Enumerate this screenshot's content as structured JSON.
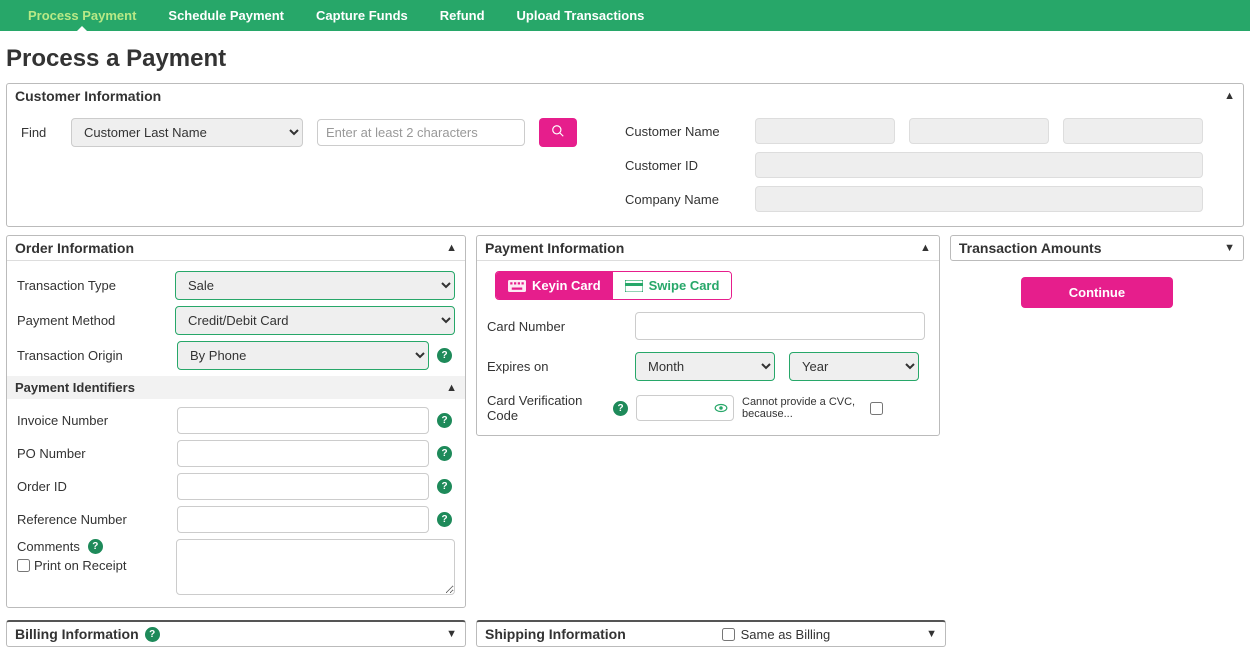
{
  "nav": {
    "items": [
      "Process Payment",
      "Schedule Payment",
      "Capture Funds",
      "Refund",
      "Upload Transactions"
    ]
  },
  "page_title": "Process a Payment",
  "customer_info": {
    "title": "Customer Information",
    "find_label": "Find",
    "find_select": "Customer Last Name",
    "search_placeholder": "Enter at least 2 characters",
    "labels": {
      "name": "Customer Name",
      "id": "Customer ID",
      "company": "Company Name"
    }
  },
  "order_info": {
    "title": "Order Information",
    "txn_type_label": "Transaction Type",
    "txn_type_value": "Sale",
    "pay_method_label": "Payment Method",
    "pay_method_value": "Credit/Debit Card",
    "txn_origin_label": "Transaction Origin",
    "txn_origin_value": "By Phone",
    "payment_identifiers_title": "Payment Identifiers",
    "invoice_label": "Invoice Number",
    "po_label": "PO Number",
    "order_id_label": "Order ID",
    "ref_label": "Reference Number",
    "comments_label": "Comments",
    "print_receipt_label": "Print on Receipt"
  },
  "payment_info": {
    "title": "Payment Information",
    "keyin_label": "Keyin Card",
    "swipe_label": "Swipe Card",
    "card_number_label": "Card Number",
    "expires_label": "Expires on",
    "month_placeholder": "Month",
    "year_placeholder": "Year",
    "cvc_label": "Card Verification Code",
    "cvc_note": "Cannot provide a CVC, because..."
  },
  "transaction_amounts": {
    "title": "Transaction Amounts",
    "continue_label": "Continue"
  },
  "billing_info": {
    "title": "Billing Information"
  },
  "shipping_info": {
    "title": "Shipping Information",
    "same_as_label": "Same as Billing"
  }
}
